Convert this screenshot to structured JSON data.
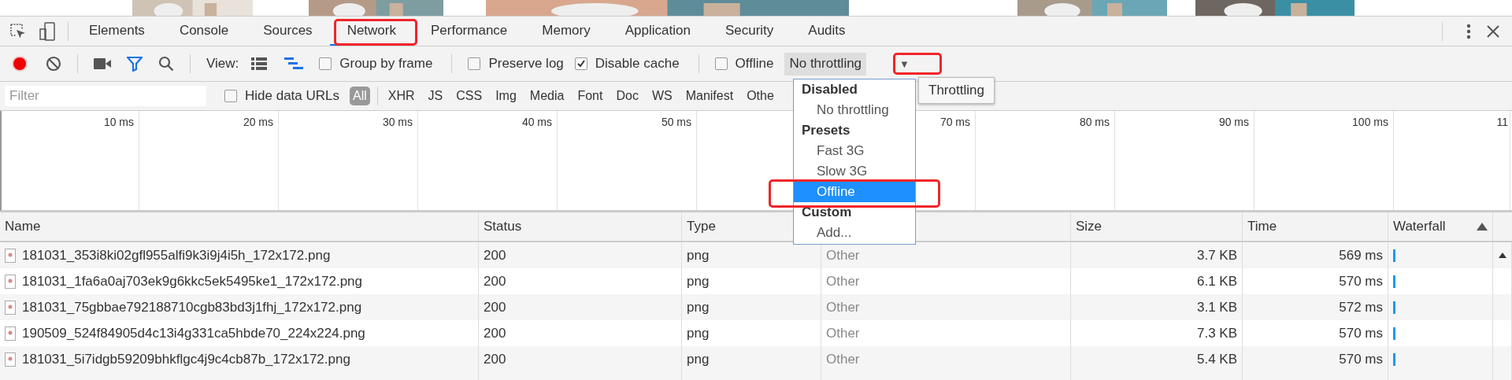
{
  "tabs": [
    {
      "label": "Elements",
      "selected": false
    },
    {
      "label": "Console",
      "selected": false
    },
    {
      "label": "Sources",
      "selected": false
    },
    {
      "label": "Network",
      "selected": true
    },
    {
      "label": "Performance",
      "selected": false
    },
    {
      "label": "Memory",
      "selected": false
    },
    {
      "label": "Application",
      "selected": false
    },
    {
      "label": "Security",
      "selected": false
    },
    {
      "label": "Audits",
      "selected": false
    }
  ],
  "toolbar": {
    "view_label": "View:",
    "options": [
      {
        "label": "Group by frame",
        "checked": false
      },
      {
        "label": "Preserve log",
        "checked": false
      },
      {
        "label": "Disable cache",
        "checked": true
      },
      {
        "label": "Offline",
        "checked": false
      }
    ],
    "throttling": "No throttling",
    "arrow": "▼"
  },
  "filter": {
    "placeholder": "Filter",
    "hide_data_urls": {
      "label": "Hide data URLs",
      "checked": false
    },
    "types": [
      {
        "label": "All",
        "selected": true
      },
      {
        "label": "XHR",
        "selected": false
      },
      {
        "label": "JS",
        "selected": false
      },
      {
        "label": "CSS",
        "selected": false
      },
      {
        "label": "Img",
        "selected": false
      },
      {
        "label": "Media",
        "selected": false
      },
      {
        "label": "Font",
        "selected": false
      },
      {
        "label": "Doc",
        "selected": false
      },
      {
        "label": "WS",
        "selected": false
      },
      {
        "label": "Manifest",
        "selected": false
      },
      {
        "label": "Othe",
        "selected": false
      }
    ]
  },
  "timeline": {
    "columns": [
      {
        "label": "10 ms"
      },
      {
        "label": "20 ms"
      },
      {
        "label": "30 ms"
      },
      {
        "label": "40 ms"
      },
      {
        "label": "50 ms"
      },
      {},
      {
        "label": "70 ms"
      },
      {
        "label": "80 ms"
      },
      {
        "label": "90 ms"
      },
      {
        "label": "100 ms"
      },
      {
        "label": "11"
      }
    ]
  },
  "table": {
    "columns": [
      {
        "label": "Name"
      },
      {
        "label": "Status"
      },
      {
        "label": "Type"
      },
      {},
      {
        "label": "Size"
      },
      {
        "label": "Time"
      },
      {
        "label": "Waterfall"
      }
    ],
    "rows": [
      {
        "name": "181031_353i8ki02gfl955alfi9k3i9j4i5h_172x172.png",
        "status": "200",
        "type": "png",
        "initiator": "Other",
        "size": "3.7 KB",
        "time": "569 ms"
      },
      {
        "name": "181031_1fa6a0aj703ek9g6kkc5ek5495ke1_172x172.png",
        "status": "200",
        "type": "png",
        "initiator": "Other",
        "size": "6.1 KB",
        "time": "570 ms"
      },
      {
        "name": "181031_75gbbae792188710cgb83bd3j1fhj_172x172.png",
        "status": "200",
        "type": "png",
        "initiator": "Other",
        "size": "3.1 KB",
        "time": "572 ms"
      },
      {
        "name": "190509_524f84905d4c13i4g331ca5hbde70_224x224.png",
        "status": "200",
        "type": "png",
        "initiator": "Other",
        "size": "7.3 KB",
        "time": "570 ms"
      },
      {
        "name": "181031_5i7idgb59209bhkflgc4j9c4cb87b_172x172.png",
        "status": "200",
        "type": "png",
        "initiator": "Other",
        "size": "5.4 KB",
        "time": "570 ms"
      }
    ]
  },
  "dropdown": {
    "items": [
      {
        "kind": "group",
        "label": "Disabled"
      },
      {
        "kind": "option",
        "label": "No throttling",
        "selected": false
      },
      {
        "kind": "group",
        "label": "Presets"
      },
      {
        "kind": "option",
        "label": "Fast 3G",
        "selected": false
      },
      {
        "kind": "option",
        "label": "Slow 3G",
        "selected": false
      },
      {
        "kind": "option",
        "label": "Offline",
        "selected": true
      },
      {
        "kind": "group",
        "label": "Custom"
      },
      {
        "kind": "option",
        "label": "Add...",
        "selected": false
      }
    ]
  },
  "tooltip": "Throttling"
}
